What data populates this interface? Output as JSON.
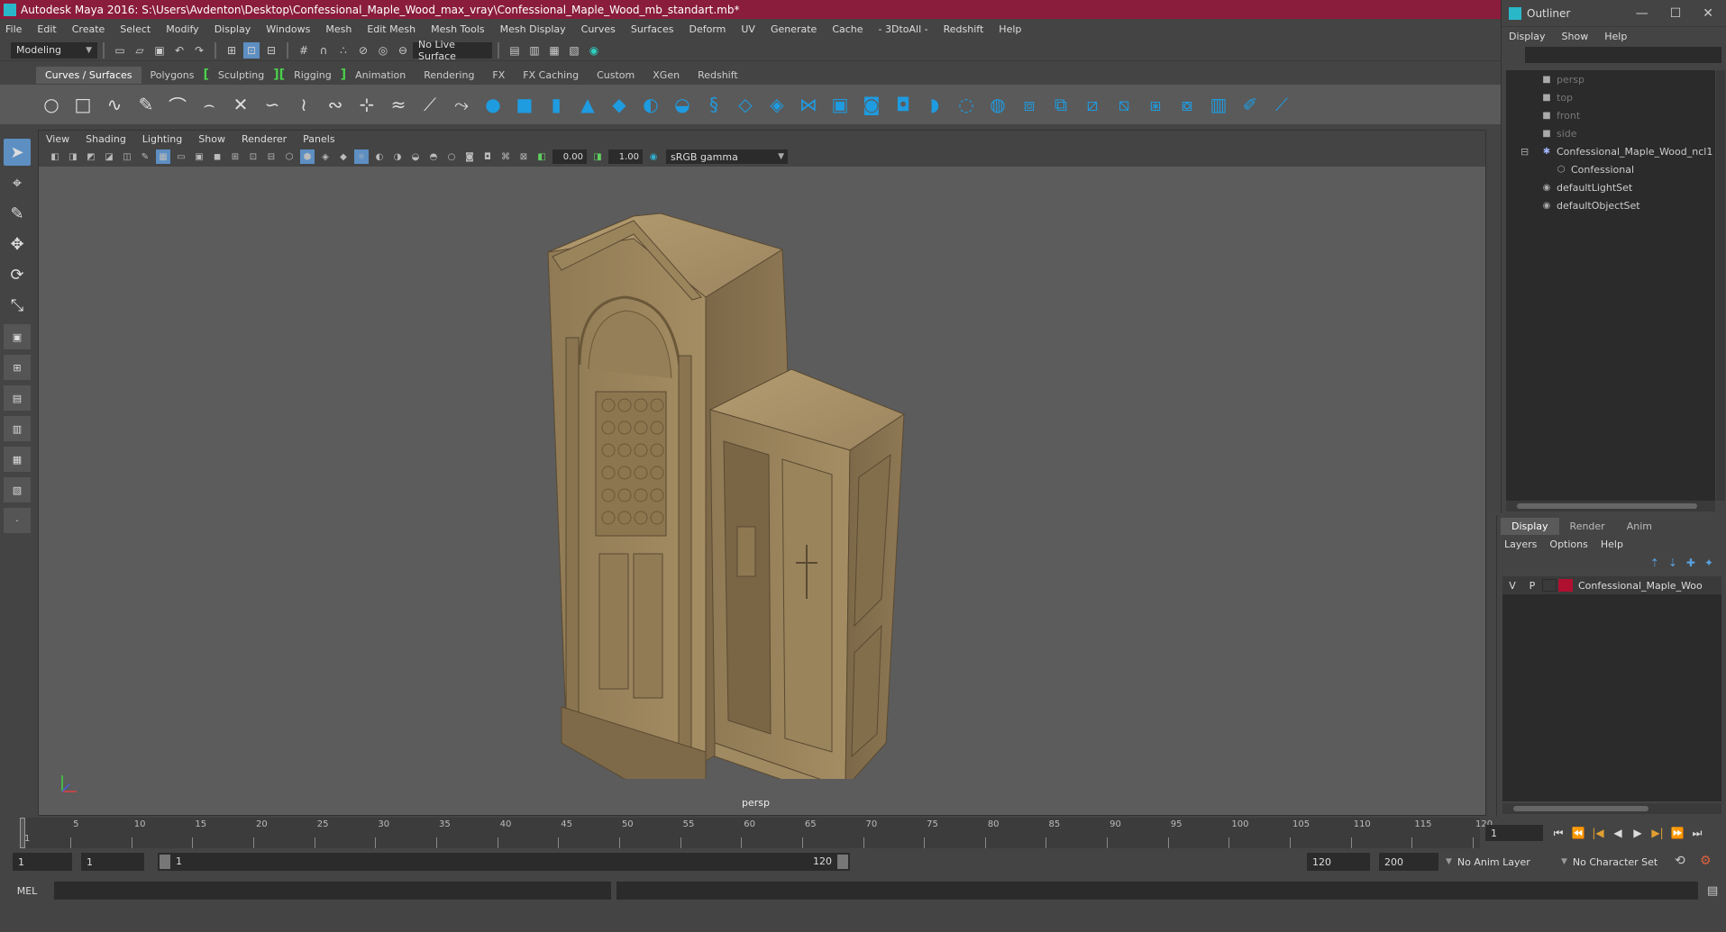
{
  "window_title": "Autodesk Maya 2016: S:\\Users\\Avdenton\\Desktop\\Confessional_Maple_Wood_max_vray\\Confessional_Maple_Wood_mb_standart.mb*",
  "main_menu": [
    "File",
    "Edit",
    "Create",
    "Select",
    "Modify",
    "Display",
    "Windows",
    "Mesh",
    "Edit Mesh",
    "Mesh Tools",
    "Mesh Display",
    "Curves",
    "Surfaces",
    "Deform",
    "UV",
    "Generate",
    "Cache",
    "- 3DtoAll -",
    "Redshift",
    "Help"
  ],
  "status_line": {
    "mode": "Modeling",
    "live_surface": "No Live Surface"
  },
  "shelf_tabs": [
    "Curves / Surfaces",
    "Polygons",
    "Sculpting",
    "Rigging",
    "Animation",
    "Rendering",
    "FX",
    "FX Caching",
    "Custom",
    "XGen",
    "Redshift"
  ],
  "shelf_tab_active": "Curves / Surfaces",
  "viewport": {
    "menu": [
      "View",
      "Shading",
      "Lighting",
      "Show",
      "Renderer",
      "Panels"
    ],
    "exposure": "0.00",
    "gamma": "1.00",
    "color_space": "sRGB gamma",
    "camera_label": "persp"
  },
  "outliner": {
    "title": "Outliner",
    "menu": [
      "Display",
      "Show",
      "Help"
    ],
    "items": [
      {
        "label": "persp",
        "icon": "camera-icon",
        "dim": true
      },
      {
        "label": "top",
        "icon": "camera-icon",
        "dim": true
      },
      {
        "label": "front",
        "icon": "camera-icon",
        "dim": true
      },
      {
        "label": "side",
        "icon": "camera-icon",
        "dim": true
      },
      {
        "label": "Confessional_Maple_Wood_ncl1",
        "icon": "group-icon",
        "dim": false
      },
      {
        "label": "Confessional",
        "icon": "mesh-icon",
        "dim": false
      },
      {
        "label": "defaultLightSet",
        "icon": "set-icon",
        "dim": false
      },
      {
        "label": "defaultObjectSet",
        "icon": "set-icon",
        "dim": false
      }
    ]
  },
  "layer_editor": {
    "tabs": [
      "Display",
      "Render",
      "Anim"
    ],
    "active_tab": "Display",
    "menu": [
      "Layers",
      "Options",
      "Help"
    ],
    "layers": [
      {
        "v": "V",
        "p": "P",
        "name": "Confessional_Maple_Woo",
        "color": "#b01030"
      }
    ]
  },
  "timeline": {
    "ticks": [
      "1",
      "5",
      "10",
      "15",
      "20",
      "25",
      "30",
      "35",
      "40",
      "45",
      "50",
      "55",
      "60",
      "65",
      "70",
      "75",
      "80",
      "85",
      "90",
      "95",
      "100",
      "105",
      "110",
      "115",
      "120"
    ],
    "current_frame": "1"
  },
  "range": {
    "start": "1",
    "inner_start": "1",
    "bar_start": "1",
    "bar_end": "120",
    "end": "120",
    "outer_end": "200",
    "anim_layer": "No Anim Layer",
    "character_set": "No Character Set"
  },
  "command_line": {
    "language": "MEL"
  }
}
